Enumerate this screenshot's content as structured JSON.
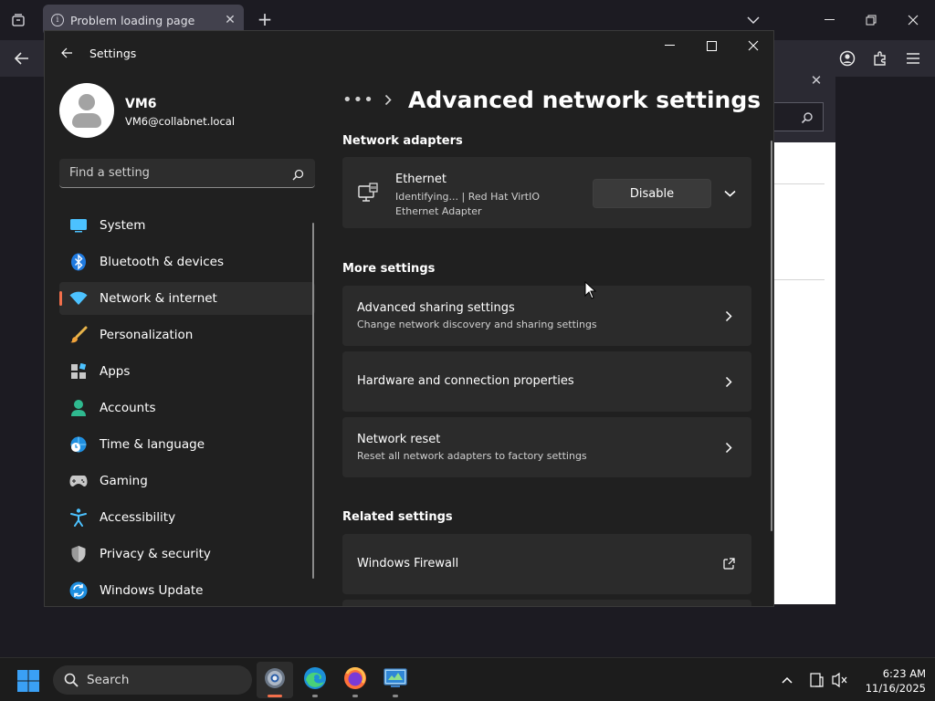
{
  "browser": {
    "tab_title": "Problem loading page"
  },
  "settings": {
    "app_title": "Settings",
    "profile": {
      "name": "VM6",
      "email": "VM6@collabnet.local"
    },
    "search_placeholder": "Find a setting",
    "nav": [
      {
        "label": "System",
        "icon": "system-icon"
      },
      {
        "label": "Bluetooth & devices",
        "icon": "bluetooth-icon"
      },
      {
        "label": "Network & internet",
        "icon": "wifi-icon",
        "active": true
      },
      {
        "label": "Personalization",
        "icon": "brush-icon"
      },
      {
        "label": "Apps",
        "icon": "apps-icon"
      },
      {
        "label": "Accounts",
        "icon": "person-icon"
      },
      {
        "label": "Time & language",
        "icon": "globe-clock-icon"
      },
      {
        "label": "Gaming",
        "icon": "gamepad-icon"
      },
      {
        "label": "Accessibility",
        "icon": "accessibility-icon"
      },
      {
        "label": "Privacy & security",
        "icon": "shield-icon"
      },
      {
        "label": "Windows Update",
        "icon": "update-icon"
      }
    ],
    "breadcrumb_more": "•••",
    "page_title": "Advanced network settings",
    "sections": {
      "adapters": "Network adapters",
      "more": "More settings",
      "related": "Related settings"
    },
    "adapter": {
      "name": "Ethernet",
      "description": "Identifying... | Red Hat VirtIO Ethernet Adapter",
      "button": "Disable"
    },
    "more_settings": [
      {
        "title": "Advanced sharing settings",
        "subtitle": "Change network discovery and sharing settings"
      },
      {
        "title": "Hardware and connection properties",
        "subtitle": ""
      },
      {
        "title": "Network reset",
        "subtitle": "Reset all network adapters to factory settings"
      }
    ],
    "related": [
      {
        "title": "Windows Firewall"
      }
    ]
  },
  "taskbar": {
    "search_label": "Search",
    "time": "6:23 AM",
    "date": "11/16/2025"
  },
  "colors": {
    "accent": "#f26f4b",
    "window_bg": "#202020",
    "card_bg": "#2b2b2b"
  }
}
